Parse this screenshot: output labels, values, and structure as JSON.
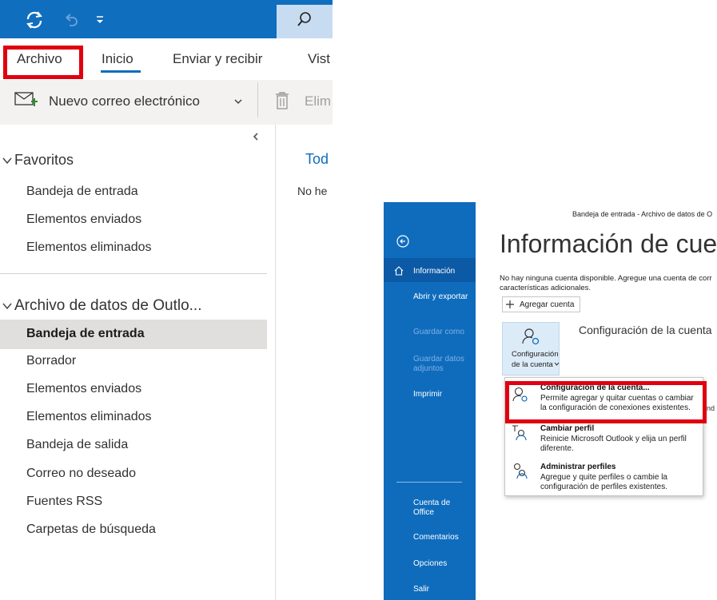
{
  "left_window": {
    "ribbon_tabs": [
      "Archivo",
      "Inicio",
      "Enviar y recibir",
      "Vist"
    ],
    "toolbar": {
      "new_email_label": "Nuevo correo electrónico",
      "delete_label": "Elim"
    },
    "favorites": {
      "title": "Favoritos",
      "items": [
        "Bandeja de entrada",
        "Elementos enviados",
        "Elementos eliminados"
      ]
    },
    "data_file": {
      "title": "Archivo de datos de Outlo...",
      "items": [
        "Bandeja de entrada",
        "Borrador",
        "Elementos enviados",
        "Elementos eliminados",
        "Bandeja de salida",
        "Correo no deseado",
        "Fuentes RSS",
        "Carpetas de búsqueda"
      ],
      "selected_index": 0
    },
    "message_list": {
      "tab_label": "Tod",
      "empty_text": "No he"
    }
  },
  "backstage": {
    "window_title": "Bandeja de entrada - Archivo de datos de O",
    "heading": "Información de cuen",
    "nav": {
      "informacion": "Información",
      "abrir_exportar": "Abrir y exportar",
      "guardar_como": "Guardar como",
      "guardar_adjuntos_1": "Guardar datos",
      "guardar_adjuntos_2": "adjuntos",
      "imprimir": "Imprimir",
      "cuenta_office_1": "Cuenta de",
      "cuenta_office_2": "Office",
      "comentarios": "Comentarios",
      "opciones": "Opciones",
      "salir": "Salir"
    },
    "no_account_line1": "No hay ninguna cuenta disponible. Agregue una cuenta de corr",
    "no_account_line2": "características adicionales.",
    "add_account_label": "Agregar cuenta",
    "account_settings_button_1": "Configuración",
    "account_settings_button_2": "de la cuenta",
    "account_settings_heading": "Configuración de la cuenta",
    "partial_text": "nd",
    "menu": [
      {
        "title": "Configuración de la cuenta...",
        "desc1": "Permite agregar y quitar cuentas o cambiar",
        "desc2": "la configuración de conexiones existentes."
      },
      {
        "title": "Cambiar perfil",
        "desc1": "Reinicie Microsoft Outlook y elija un perfil",
        "desc2": "diferente."
      },
      {
        "title": "Administrar perfiles",
        "desc1": "Agregue y quite perfiles o cambie la",
        "desc2": "configuración de perfiles existentes."
      }
    ]
  },
  "colors": {
    "accent_blue": "#0f6cbd",
    "highlight_red": "#e0000f",
    "selected_gray": "#e1dfdd"
  }
}
